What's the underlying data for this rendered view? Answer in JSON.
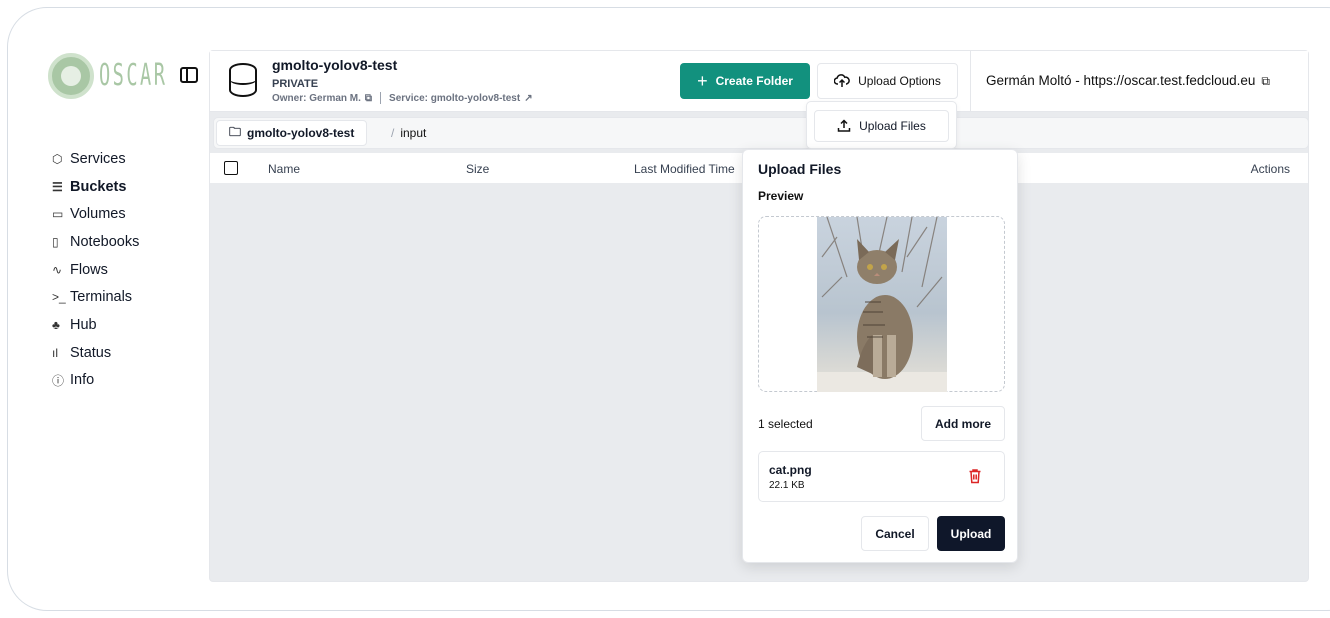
{
  "brand": {
    "name": "OSCAR",
    "color": "#a9c7a5"
  },
  "sidebar": {
    "items": [
      {
        "label": "Services",
        "icon": "package-icon"
      },
      {
        "label": "Buckets",
        "icon": "database-icon",
        "active": true
      },
      {
        "label": "Volumes",
        "icon": "hard-drive-icon"
      },
      {
        "label": "Notebooks",
        "icon": "notebook-icon"
      },
      {
        "label": "Flows",
        "icon": "workflow-icon"
      },
      {
        "label": "Terminals",
        "icon": "terminal-icon"
      },
      {
        "label": "Hub",
        "icon": "hub-icon"
      },
      {
        "label": "Status",
        "icon": "bar-chart-icon"
      },
      {
        "label": "Info",
        "icon": "info-icon"
      }
    ]
  },
  "bucket": {
    "title": "gmolto-yolov8-test",
    "visibility": "PRIVATE",
    "owner": "Owner: German M.",
    "service": "Service: gmolto-yolov8-test"
  },
  "toolbar": {
    "create_folder": "Create Folder",
    "upload_options": "Upload Options",
    "accent": "#12917e"
  },
  "user": {
    "label": "Germán Moltó - https://oscar.test.fedcloud.eu"
  },
  "breadcrumb": {
    "root": "gmolto-yolov8-test",
    "current": "input"
  },
  "table": {
    "headers": {
      "name": "Name",
      "size": "Size",
      "modified": "Last Modified Time",
      "actions": "Actions"
    }
  },
  "dropdown": {
    "upload_files": "Upload Files"
  },
  "dialog": {
    "title": "Upload Files",
    "preview_label": "Preview",
    "selected_text": "1 selected",
    "add_more": "Add more",
    "file": {
      "name": "cat.png",
      "size": "22.1 KB"
    },
    "cancel": "Cancel",
    "upload": "Upload",
    "danger_color": "#dc2626"
  }
}
